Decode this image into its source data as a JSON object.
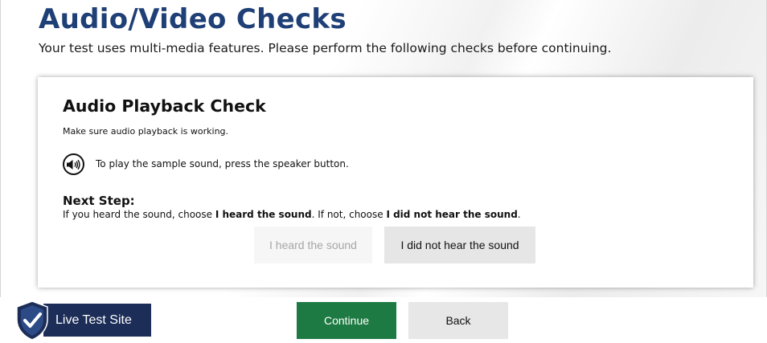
{
  "header": {
    "title": "Audio/Video Checks",
    "subtitle": "Your test uses multi-media features. Please perform the following checks before continuing."
  },
  "audio_check": {
    "title": "Audio Playback Check",
    "description": "Make sure audio playback is working.",
    "speaker_icon": "speaker-icon",
    "speaker_instruction": "To play the sample sound, press the speaker button.",
    "next_step_label": "Next Step:",
    "next_step_prefix": "If you heard the sound, choose ",
    "next_step_heard": "I heard the sound",
    "next_step_middle": ". If not, choose ",
    "next_step_not_heard": "I did not hear the sound",
    "next_step_suffix": ".",
    "heard_button": "I heard the sound",
    "not_heard_button": "I did not hear the sound"
  },
  "footer": {
    "badge_label": "Live Test Site",
    "badge_icon": "shield-check-icon",
    "continue_button": "Continue",
    "back_button": "Back"
  },
  "colors": {
    "title": "#1f3f77",
    "badge_bg": "#1c2d57",
    "continue_bg": "#1e7a43",
    "disabled_text": "#a6a6a6"
  }
}
